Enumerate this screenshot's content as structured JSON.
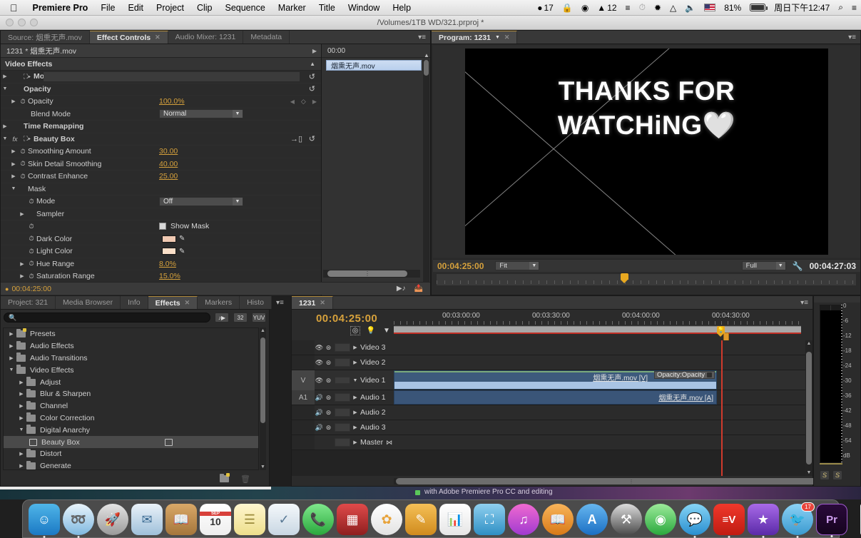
{
  "menubar": {
    "apple_icon": "apple-icon",
    "app_name": "Premiere Pro",
    "items": [
      "File",
      "Edit",
      "Project",
      "Clip",
      "Sequence",
      "Marker",
      "Title",
      "Window",
      "Help"
    ],
    "status": {
      "dropbox_count": "17",
      "adobe_cc_count": "12",
      "battery_percent": "81%",
      "clock": "周日下午12:47",
      "icons": [
        "dropbox-icon",
        "vpn-icon",
        "circle-icon",
        "adobe-cc-icon",
        "evernote-icon",
        "timemachine-icon",
        "bluetooth-icon",
        "wifi-icon",
        "volume-icon",
        "us-flag-icon",
        "battery-icon",
        "spotlight-search-icon",
        "notification-center-icon"
      ]
    }
  },
  "window": {
    "title": "/Volumes/1TB WD/321.prproj *"
  },
  "effect_controls": {
    "tabs": [
      {
        "label": "Source: 烟熏无声.mov",
        "active": false
      },
      {
        "label": "Effect Controls",
        "active": true,
        "closable": true
      },
      {
        "label": "Audio Mixer: 1231",
        "active": false
      },
      {
        "label": "Metadata",
        "active": false
      }
    ],
    "clip_header": "1231 * 烟熏无声.mov",
    "section": "Video Effects",
    "timeline_header": "00:00",
    "timeline_clip": "烟熏无声.mov",
    "status_time": "00:04:25:00",
    "properties": [
      {
        "name": "Motion",
        "type": "effect-group",
        "expanded": false,
        "has_reset": true,
        "has_fx": false,
        "has_transform": true
      },
      {
        "name": "Opacity",
        "type": "effect-group",
        "expanded": true,
        "has_reset": true,
        "has_fx": false,
        "has_transform": false
      },
      {
        "name": "Opacity",
        "type": "value",
        "value": "100.0",
        "unit": "%",
        "indent": 1,
        "stopwatch": true,
        "keyframe_nav": true
      },
      {
        "name": "Blend Mode",
        "type": "dropdown",
        "value": "Normal",
        "indent": 2
      },
      {
        "name": "Time Remapping",
        "type": "effect-group",
        "expanded": false,
        "has_reset": false
      },
      {
        "name": "Beauty Box",
        "type": "effect-group",
        "expanded": true,
        "has_reset": true,
        "has_fx": true,
        "has_transform": true,
        "has_setup": true
      },
      {
        "name": "Smoothing Amount",
        "type": "value",
        "value": "30.00",
        "unit": "",
        "indent": 1,
        "stopwatch": true
      },
      {
        "name": "Skin Detail Smoothing",
        "type": "value",
        "value": "40.00",
        "unit": "",
        "indent": 1,
        "stopwatch": true
      },
      {
        "name": "Contrast Enhance",
        "type": "value",
        "value": "25.00",
        "unit": "",
        "indent": 1,
        "stopwatch": true
      },
      {
        "name": "Mask",
        "type": "group",
        "expanded": true,
        "indent": 1
      },
      {
        "name": "Mode",
        "type": "dropdown",
        "value": "Off",
        "indent": 2,
        "stopwatch": true
      },
      {
        "name": "Sampler",
        "type": "group",
        "expanded": false,
        "indent": 2
      },
      {
        "name": "Show Mask",
        "type": "checkbox",
        "checked": false,
        "indent": 2,
        "stopwatch": true
      },
      {
        "name": "Dark Color",
        "type": "color",
        "color": "#f0c9b2",
        "indent": 2,
        "stopwatch": true
      },
      {
        "name": "Light Color",
        "type": "color",
        "color": "#fadfc8",
        "indent": 2,
        "stopwatch": true
      },
      {
        "name": "Hue Range",
        "type": "value",
        "value": "8.0",
        "unit": "%",
        "indent": 1,
        "stopwatch": true
      },
      {
        "name": "Saturation Range",
        "type": "value",
        "value": "15.0",
        "unit": "%",
        "indent": 1,
        "stopwatch": true
      }
    ]
  },
  "program_monitor": {
    "tab_label": "Program: 1231",
    "video_text_line1": "THANKS FOR",
    "video_text_line2": "WATCHiNG",
    "heart": "🤍",
    "current_time": "00:04:25:00",
    "fit_label": "Fit",
    "quality_label": "Full",
    "duration": "00:04:27:03",
    "transport_buttons": [
      {
        "name": "add-marker-button",
        "glyph": "⮟"
      },
      {
        "name": "mark-in-button",
        "glyph": "{"
      },
      {
        "name": "mark-out-button",
        "glyph": "}"
      },
      {
        "name": "go-to-in-button",
        "glyph": "{←"
      },
      {
        "name": "step-back-button",
        "glyph": "◀|"
      },
      {
        "name": "play-stop-button",
        "glyph": "▶"
      },
      {
        "name": "step-forward-button",
        "glyph": "|▶"
      },
      {
        "name": "go-to-out-button",
        "glyph": "→}"
      },
      {
        "name": "lift-button",
        "glyph": "⊟"
      },
      {
        "name": "extract-button",
        "glyph": "⊞"
      },
      {
        "name": "export-frame-button",
        "glyph": "▣"
      }
    ]
  },
  "effects_panel": {
    "tabs": [
      {
        "label": "Project: 321",
        "active": false
      },
      {
        "label": "Media Browser",
        "active": false
      },
      {
        "label": "Info",
        "active": false
      },
      {
        "label": "Effects",
        "active": true,
        "closable": true
      },
      {
        "label": "Markers",
        "active": false
      },
      {
        "label": "Histo",
        "active": false
      }
    ],
    "search_placeholder": "",
    "filter_buttons": [
      "accelerated-effect-filter",
      "32-bit-color-filter",
      "yuv-color-filter"
    ],
    "tree": [
      {
        "label": "Presets",
        "level": 0,
        "expanded": false,
        "icon": "folder-new-icon"
      },
      {
        "label": "Audio Effects",
        "level": 0,
        "expanded": false,
        "icon": "folder-icon"
      },
      {
        "label": "Audio Transitions",
        "level": 0,
        "expanded": false,
        "icon": "folder-icon"
      },
      {
        "label": "Video Effects",
        "level": 0,
        "expanded": true,
        "icon": "folder-icon"
      },
      {
        "label": "Adjust",
        "level": 1,
        "expanded": false,
        "icon": "folder-icon"
      },
      {
        "label": "Blur & Sharpen",
        "level": 1,
        "expanded": false,
        "icon": "folder-icon"
      },
      {
        "label": "Channel",
        "level": 1,
        "expanded": false,
        "icon": "folder-icon"
      },
      {
        "label": "Color Correction",
        "level": 1,
        "expanded": false,
        "icon": "folder-icon"
      },
      {
        "label": "Digital Anarchy",
        "level": 1,
        "expanded": true,
        "icon": "folder-icon"
      },
      {
        "label": "Beauty Box",
        "level": 2,
        "selected": true,
        "icon": "effect-icon",
        "badge": "32-bit-badge"
      },
      {
        "label": "Distort",
        "level": 1,
        "expanded": false,
        "icon": "folder-icon"
      },
      {
        "label": "Generate",
        "level": 1,
        "expanded": false,
        "icon": "folder-icon"
      }
    ]
  },
  "tool_palette": {
    "tools": [
      {
        "name": "selection-tool",
        "glyph": "➤",
        "active": true
      },
      {
        "name": "track-select-tool",
        "glyph": "⇥"
      },
      {
        "name": "ripple-edit-tool",
        "glyph": "↔"
      },
      {
        "name": "rolling-edit-tool",
        "glyph": "⇔"
      },
      {
        "name": "rate-stretch-tool",
        "glyph": "↕"
      },
      {
        "name": "razor-tool",
        "glyph": "╱"
      },
      {
        "name": "slip-tool",
        "glyph": "⬌"
      },
      {
        "name": "slide-tool",
        "glyph": "⬍"
      },
      {
        "name": "pen-tool",
        "glyph": "✒"
      },
      {
        "name": "hand-tool",
        "glyph": "✋"
      },
      {
        "name": "zoom-tool",
        "glyph": "⌕"
      }
    ]
  },
  "timeline": {
    "tab_label": "1231",
    "current_time": "00:04:25:00",
    "ruler_labels": [
      "00:03:00:00",
      "00:03:30:00",
      "00:04:00:00",
      "00:04:30:00"
    ],
    "header_icons": [
      "snap-toggle-icon",
      "marker-icon",
      "add-marker-icon"
    ],
    "tracks": [
      {
        "name": "Video 3",
        "type": "video",
        "source_patch": "",
        "expanded": false,
        "has_clip": false
      },
      {
        "name": "Video 2",
        "type": "video",
        "source_patch": "",
        "expanded": false,
        "has_clip": false
      },
      {
        "name": "Video 1",
        "type": "video",
        "source_patch": "V",
        "expanded": true,
        "has_clip": true,
        "clip_label": "烟熏无声.mov [V]",
        "keyframe_label": "Opacity:Opacity"
      },
      {
        "name": "Audio 1",
        "type": "audio",
        "source_patch": "A1",
        "expanded": false,
        "has_clip": true,
        "clip_label": "烟熏无声.mov [A]"
      },
      {
        "name": "Audio 2",
        "type": "audio",
        "source_patch": "",
        "expanded": false,
        "has_clip": false
      },
      {
        "name": "Audio 3",
        "type": "audio",
        "source_patch": "",
        "expanded": false,
        "has_clip": false
      },
      {
        "name": "Master",
        "type": "master",
        "source_patch": "",
        "expanded": false,
        "has_clip": false
      }
    ]
  },
  "audio_meters": {
    "scale_labels": [
      "0",
      "-6",
      "-12",
      "-18",
      "-24",
      "-30",
      "-36",
      "-42",
      "-48",
      "-54",
      "dB"
    ],
    "solo_buttons": [
      "S",
      "S"
    ]
  },
  "desktop": {
    "background_window_title": "with Adobe Premiere Pro CC and editing"
  },
  "dock": {
    "items": [
      {
        "name": "finder-icon",
        "glyph": "☺",
        "color1": "#4fb5e8",
        "color2": "#1b79c4",
        "square": true,
        "running": true
      },
      {
        "name": "safari-icon",
        "glyph": "⦿",
        "color1": "#e9f4fb",
        "color2": "#7fb8e0",
        "round": true,
        "running": true
      },
      {
        "name": "launchpad-icon",
        "glyph": "▲",
        "color1": "#d4d4d4",
        "color2": "#9a9a9a",
        "round": true
      },
      {
        "name": "mail-icon",
        "glyph": "✉",
        "color1": "#d8e6f2",
        "color2": "#88a9c2",
        "square": true
      },
      {
        "name": "contacts-icon",
        "glyph": "Ὅ2",
        "color1": "#d9a868",
        "color2": "#a5763c",
        "square": true
      },
      {
        "name": "calendar-icon",
        "glyph": "10",
        "color1": "#ffffff",
        "color2": "#e8e8e8",
        "square": true
      },
      {
        "name": "notes-icon",
        "glyph": "☰",
        "color1": "#fff3c0",
        "color2": "#f0dd82",
        "square": true
      },
      {
        "name": "reminders-icon",
        "glyph": "✓",
        "color1": "#eef2f6",
        "color2": "#c7d3de",
        "square": true
      },
      {
        "name": "facetime-icon",
        "glyph": "☎",
        "color1": "#6fe07a",
        "color2": "#2aa83d",
        "square": true
      },
      {
        "name": "photobooth-icon",
        "glyph": "▣",
        "color1": "#e04a4a",
        "color2": "#8e1f1f",
        "square": true
      },
      {
        "name": "photos-icon",
        "glyph": "✿",
        "color1": "#ffffff",
        "color2": "#e0e0e0",
        "round": true
      },
      {
        "name": "pages-icon",
        "glyph": "✎",
        "color1": "#f5b73c",
        "color2": "#d08b1e",
        "square": true
      },
      {
        "name": "numbers-icon",
        "glyph": "▐",
        "color1": "#ffffff",
        "color2": "#e4e4e4",
        "square": true
      },
      {
        "name": "keynote-icon",
        "glyph": "▭",
        "color1": "#70c3e8",
        "color2": "#2f8fc4",
        "square": true
      },
      {
        "name": "itunes-icon",
        "glyph": "♫",
        "color1": "#f06ad0",
        "color2": "#a03ad0",
        "round": true
      },
      {
        "name": "ibooks-icon",
        "glyph": "◖",
        "color1": "#f6a23a",
        "color2": "#d87a18",
        "round": true
      },
      {
        "name": "appstore-icon",
        "glyph": "A",
        "color1": "#4fa8e8",
        "color2": "#1b6fc4",
        "round": true
      },
      {
        "name": "xcode-icon",
        "glyph": "⚒",
        "color1": "#cfcfcf",
        "color2": "#555555",
        "round": true
      },
      {
        "name": "airdrop-icon",
        "glyph": "◎",
        "color1": "#7ee07a",
        "color2": "#2aa83d",
        "round": true
      },
      {
        "name": "messages-icon",
        "glyph": "●",
        "color1": "#6fc7f0",
        "color2": "#2a8fd0",
        "round": true,
        "running": true
      },
      {
        "name": "evernote-icon",
        "glyph": "≡V",
        "color1": "#f0382b",
        "color2": "#c01c12",
        "square": true,
        "running": true
      },
      {
        "name": "imovie-icon",
        "glyph": "★",
        "color1": "#9a5ae0",
        "color2": "#5a2aa8",
        "square": true,
        "running": true
      },
      {
        "name": "twitter-icon",
        "glyph": "◔",
        "color1": "#7cc8f0",
        "color2": "#3a9ad0",
        "round": true,
        "badge": "17",
        "running": true
      },
      {
        "name": "premiere-pro-icon",
        "glyph": "Pr",
        "color1": "#2a0a3a",
        "color2": "#1a0526",
        "square": true,
        "running": true
      },
      {
        "name": "minimized-window-1",
        "glyph": "",
        "color1": "#f2f2f2",
        "color2": "#d8d8d8",
        "square": true
      },
      {
        "name": "minimized-window-2",
        "glyph": "",
        "color1": "#f2f2f2",
        "color2": "#d8d8d8",
        "square": true
      },
      {
        "name": "minimized-window-3",
        "glyph": "",
        "color1": "#f2f2f2",
        "color2": "#d8d8d8",
        "square": true
      },
      {
        "name": "minimized-window-4",
        "glyph": "",
        "color1": "#1a1a1a",
        "color2": "#0a0a0a",
        "square": true
      },
      {
        "name": "minimized-window-5",
        "glyph": "",
        "color1": "#f2f2f2",
        "color2": "#d8d8d8",
        "square": true
      },
      {
        "name": "trash-icon",
        "glyph": "Ὕ1",
        "color1": "#e8e8e8",
        "color2": "#b8b8b8",
        "square": true
      }
    ]
  },
  "colors": {
    "accent_orange": "#d6a13c",
    "panel_bg": "#2b2b2b",
    "tab_active": "#4a4a4a",
    "playhead_red": "#d03a2c"
  }
}
